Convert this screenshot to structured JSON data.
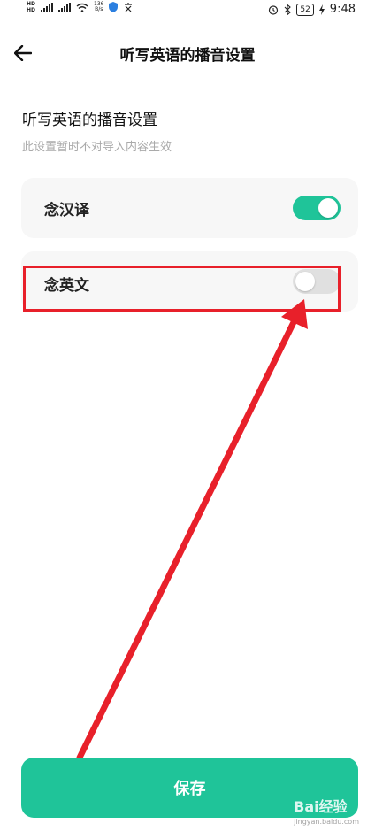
{
  "status_bar": {
    "hd1": "HD",
    "hd2": "HD",
    "net_speed_value": "136",
    "net_speed_unit": "B/s",
    "battery": "52",
    "time": "9:48"
  },
  "header": {
    "title": "听写英语的播音设置"
  },
  "section": {
    "title": "听写英语的播音设置",
    "subtitle": "此设置暂时不对导入内容生效"
  },
  "options": [
    {
      "label": "念汉译",
      "enabled": true
    },
    {
      "label": "念英文",
      "enabled": false
    }
  ],
  "save_button": {
    "label": "保存"
  },
  "watermark": {
    "text": "Bai经验",
    "sub": "jingyan.baidu.com"
  },
  "colors": {
    "accent": "#1fc499",
    "annotation": "#e8202a"
  }
}
